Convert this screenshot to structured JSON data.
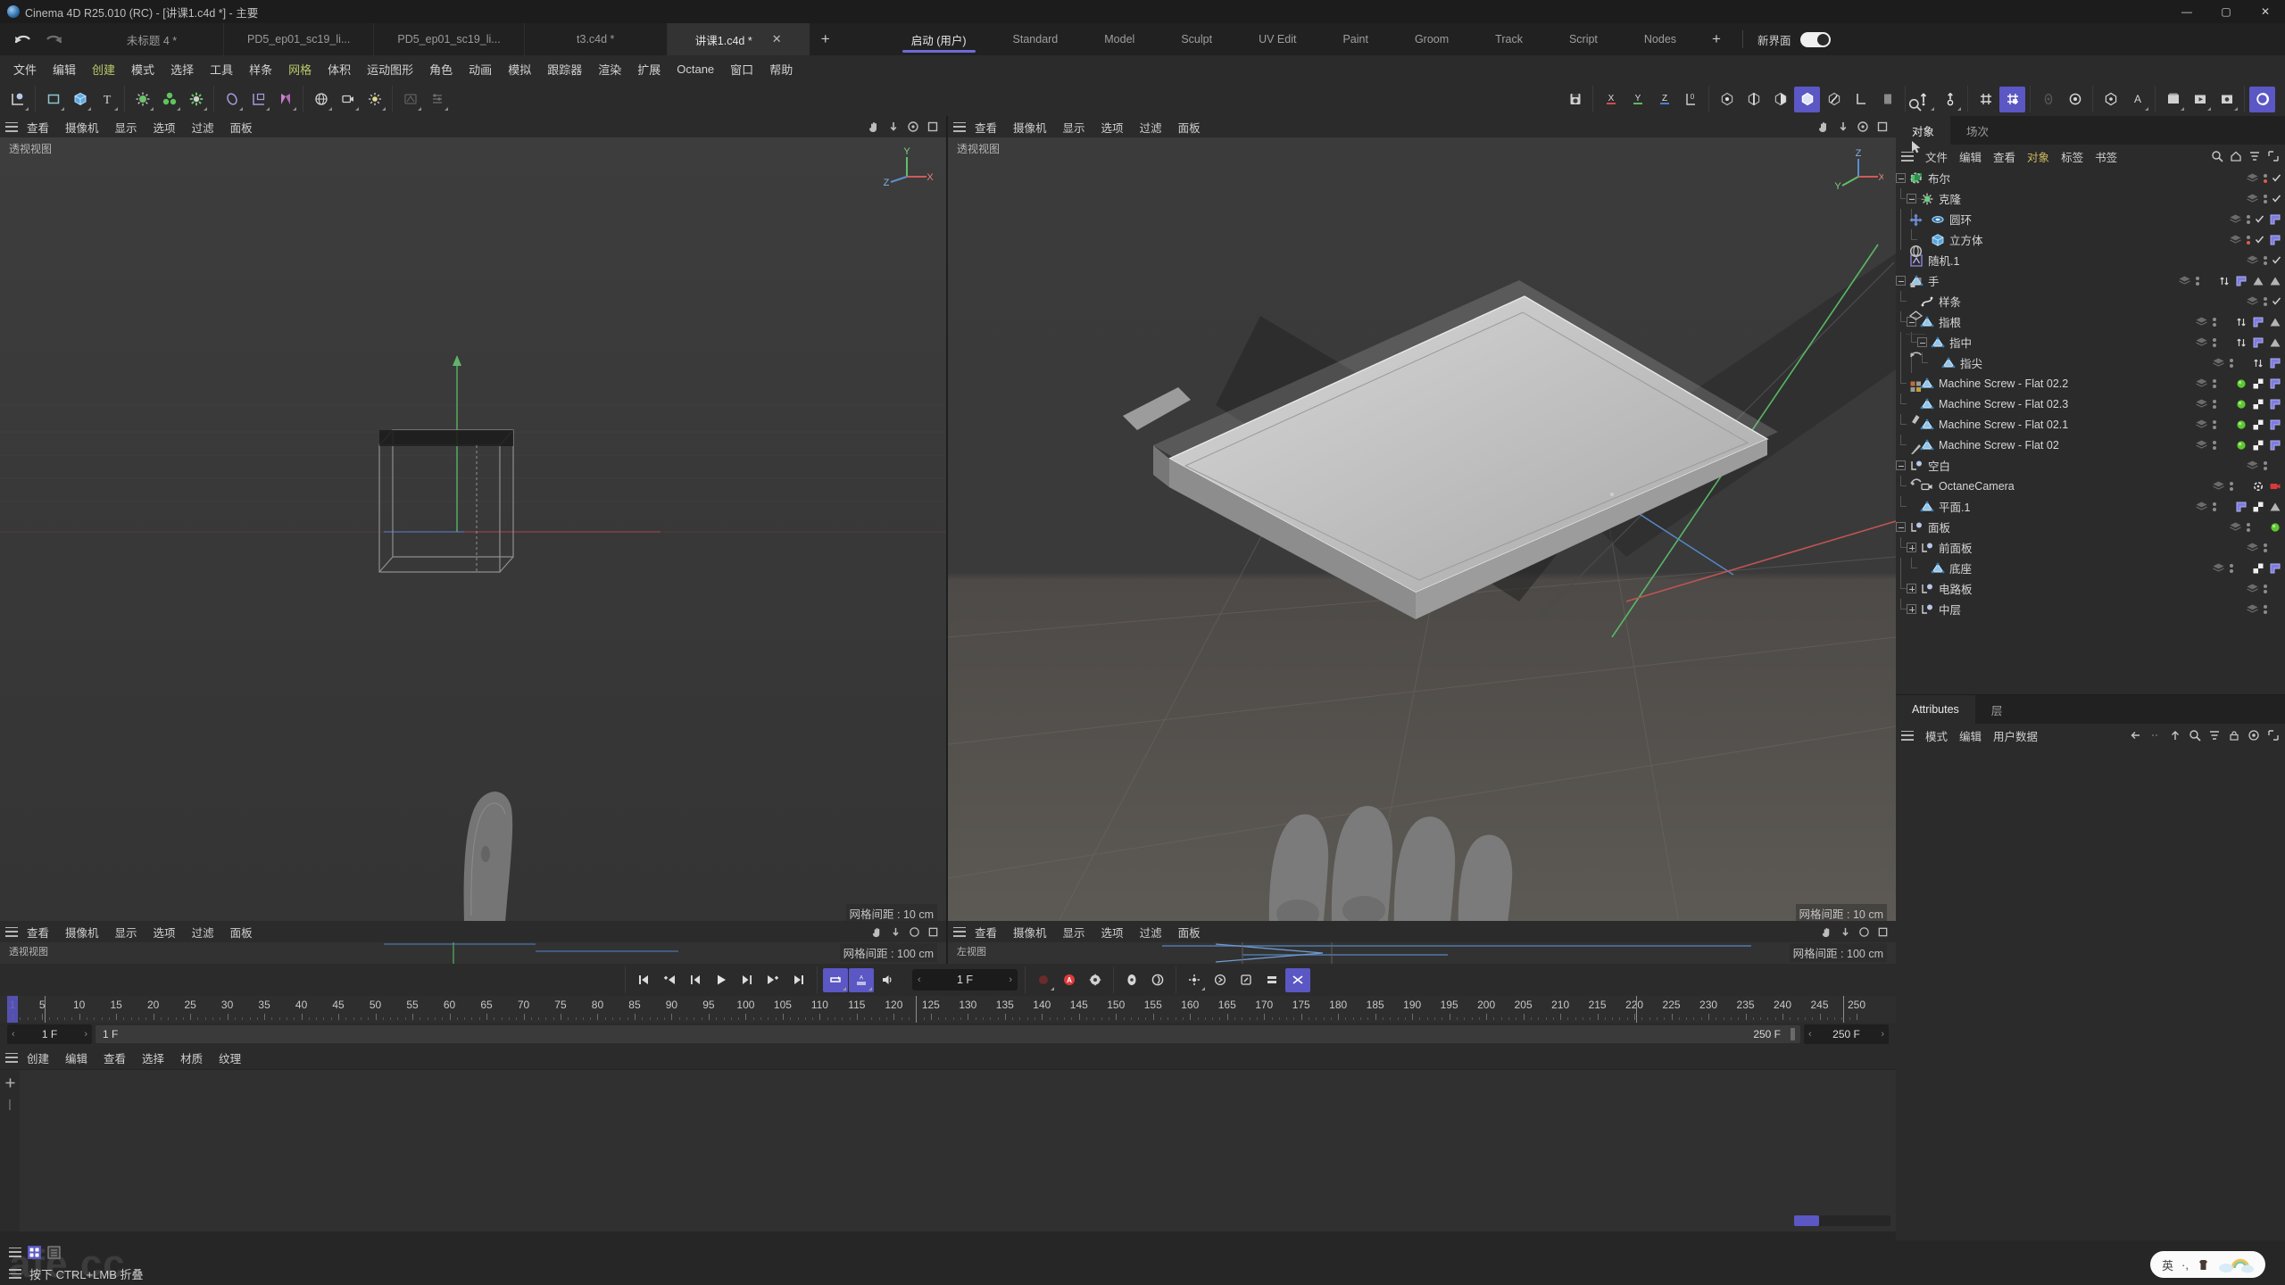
{
  "window": {
    "title": "Cinema 4D R25.010 (RC) - [讲课1.c4d *] - 主要",
    "minimize": "—",
    "maximize": "▢",
    "close": "✕"
  },
  "doc_tabs": [
    {
      "label": "未标题 4 *",
      "active": false,
      "closable": false
    },
    {
      "label": "PD5_ep01_sc19_li...",
      "active": false,
      "closable": false
    },
    {
      "label": "PD5_ep01_sc19_li...",
      "active": false,
      "closable": false
    },
    {
      "label": "t3.c4d *",
      "active": false,
      "closable": false
    },
    {
      "label": "讲课1.c4d *",
      "active": true,
      "closable": true
    }
  ],
  "doc_tab_add": "+",
  "layout_tabs": [
    {
      "label": "启动 (用户)",
      "active": true
    },
    {
      "label": "Standard",
      "active": false
    },
    {
      "label": "Model",
      "active": false
    },
    {
      "label": "Sculpt",
      "active": false
    },
    {
      "label": "UV Edit",
      "active": false
    },
    {
      "label": "Paint",
      "active": false
    },
    {
      "label": "Groom",
      "active": false
    },
    {
      "label": "Track",
      "active": false
    },
    {
      "label": "Script",
      "active": false
    },
    {
      "label": "Nodes",
      "active": false
    }
  ],
  "layout_add": "+",
  "new_ui": {
    "label": "新界面",
    "enabled": true
  },
  "menubar": [
    {
      "label": "文件",
      "hl": false
    },
    {
      "label": "编辑",
      "hl": false
    },
    {
      "label": "创建",
      "hl": true
    },
    {
      "label": "模式",
      "hl": false
    },
    {
      "label": "选择",
      "hl": false
    },
    {
      "label": "工具",
      "hl": false
    },
    {
      "label": "样条",
      "hl": false
    },
    {
      "label": "网格",
      "hl": true
    },
    {
      "label": "体积",
      "hl": false
    },
    {
      "label": "运动图形",
      "hl": false
    },
    {
      "label": "角色",
      "hl": false
    },
    {
      "label": "动画",
      "hl": false
    },
    {
      "label": "模拟",
      "hl": false
    },
    {
      "label": "跟踪器",
      "hl": false
    },
    {
      "label": "渲染",
      "hl": false
    },
    {
      "label": "扩展",
      "hl": false
    },
    {
      "label": "Octane",
      "hl": false
    },
    {
      "label": "窗口",
      "hl": false
    },
    {
      "label": "帮助",
      "hl": false
    }
  ],
  "viewports": {
    "menu": [
      "查看",
      "摄像机",
      "显示",
      "选项",
      "过滤",
      "面板"
    ],
    "left": {
      "label": "透视视图",
      "grid": "网格间距 : 10 cm"
    },
    "right": {
      "label": "透视视图",
      "grid": "网格间距 : 10 cm"
    },
    "left_bottom": {
      "label": "透视视图",
      "grid": "网格间距 : 100 cm"
    },
    "right_bottom": {
      "label": "左视图",
      "grid": "网格间距 : 100 cm"
    },
    "axis_labels": {
      "x": "X",
      "y": "Y",
      "z": "Z"
    }
  },
  "transport": {
    "current_frame": "1 F",
    "buttons": [
      "go-to-start",
      "previous-key",
      "previous-frame",
      "play",
      "next-frame",
      "next-key",
      "go-to-end"
    ],
    "loop": "loop",
    "sound": "sound"
  },
  "timeline": {
    "start": "1 F",
    "end": "250 F",
    "preview_min": "1 F",
    "preview_max": "250 F",
    "playhead": 1,
    "range_start": 1,
    "range_end": 250,
    "tick_step": 5,
    "ticks": [
      1,
      5,
      10,
      15,
      20,
      25,
      30,
      35,
      40,
      45,
      50,
      55,
      60,
      65,
      70,
      75,
      80,
      85,
      90,
      95,
      100,
      105,
      110,
      115,
      120,
      125,
      130,
      135,
      140,
      145,
      150,
      155,
      160,
      165,
      170,
      175,
      180,
      185,
      190,
      195,
      200,
      205,
      210,
      215,
      220,
      225,
      230,
      235,
      240,
      245,
      250
    ]
  },
  "material_manager": {
    "menu": [
      "创建",
      "编辑",
      "查看",
      "选择",
      "材质",
      "纹理"
    ]
  },
  "object_manager": {
    "tabs": [
      {
        "label": "对象",
        "active": true
      },
      {
        "label": "场次",
        "active": false
      }
    ],
    "menu": [
      {
        "label": "文件",
        "hl": false
      },
      {
        "label": "编辑",
        "hl": false
      },
      {
        "label": "查看",
        "hl": false
      },
      {
        "label": "对象",
        "hl": true
      },
      {
        "label": "标签",
        "hl": false
      },
      {
        "label": "书签",
        "hl": false
      }
    ],
    "items": [
      {
        "name": "布尔",
        "depth": 0,
        "expander": "open",
        "icon": "boole-icon",
        "dot": "red",
        "check": true,
        "tags": []
      },
      {
        "name": "克隆",
        "depth": 1,
        "expander": "open",
        "icon": "cloner-icon",
        "dot": "none",
        "check": true,
        "tags": []
      },
      {
        "name": "圆环",
        "depth": 2,
        "expander": "none",
        "icon": "circle-icon",
        "dot": "none",
        "check": true,
        "tags": [
          "flag"
        ]
      },
      {
        "name": "立方体",
        "depth": 2,
        "expander": "none",
        "icon": "cube-icon",
        "dot": "red",
        "check": true,
        "tags": [
          "flag"
        ]
      },
      {
        "name": "随机.1",
        "depth": 0,
        "expander": "none",
        "icon": "random-icon",
        "dot": "none",
        "check": true,
        "tags": []
      },
      {
        "name": "手",
        "depth": 0,
        "expander": "open",
        "icon": "poly-icon",
        "dot": "none",
        "check": false,
        "tags": [
          "updown",
          "flag",
          "tri",
          "tri"
        ]
      },
      {
        "name": "样条",
        "depth": 1,
        "expander": "none",
        "icon": "spline-icon",
        "dot": "none",
        "check": true,
        "tags": []
      },
      {
        "name": "指根",
        "depth": 1,
        "expander": "open",
        "icon": "poly-icon",
        "dot": "none",
        "check": false,
        "tags": [
          "updown",
          "flag",
          "tri"
        ]
      },
      {
        "name": "指中",
        "depth": 2,
        "expander": "open",
        "icon": "poly-icon",
        "dot": "none",
        "check": false,
        "tags": [
          "updown",
          "flag",
          "tri"
        ]
      },
      {
        "name": "指尖",
        "depth": 3,
        "expander": "none",
        "icon": "poly-icon",
        "dot": "none",
        "check": false,
        "tags": [
          "updown",
          "flag"
        ]
      },
      {
        "name": "Machine Screw - Flat 02.2",
        "depth": 1,
        "expander": "none",
        "icon": "poly-icon",
        "dot": "none",
        "check": false,
        "tags": [
          "green",
          "checker",
          "flag"
        ]
      },
      {
        "name": "Machine Screw - Flat 02.3",
        "depth": 1,
        "expander": "none",
        "icon": "poly-icon",
        "dot": "none",
        "check": false,
        "tags": [
          "green",
          "checker",
          "flag"
        ]
      },
      {
        "name": "Machine Screw - Flat 02.1",
        "depth": 1,
        "expander": "none",
        "icon": "poly-icon",
        "dot": "none",
        "check": false,
        "tags": [
          "green",
          "checker",
          "flag"
        ]
      },
      {
        "name": "Machine Screw - Flat 02",
        "depth": 1,
        "expander": "none",
        "icon": "poly-icon",
        "dot": "none",
        "check": false,
        "tags": [
          "green",
          "checker",
          "flag"
        ]
      },
      {
        "name": "空白",
        "depth": 0,
        "expander": "open",
        "icon": "null-icon",
        "dot": "none",
        "check": false,
        "tags": []
      },
      {
        "name": "OctaneCamera",
        "depth": 1,
        "expander": "none",
        "icon": "camera-icon",
        "dot": "none",
        "check": false,
        "tags": [
          "target",
          "redcam"
        ]
      },
      {
        "name": "平面.1",
        "depth": 1,
        "expander": "none",
        "icon": "poly-icon",
        "dot": "none",
        "check": false,
        "tags": [
          "flag",
          "checker",
          "tri"
        ]
      },
      {
        "name": "面板",
        "depth": 0,
        "expander": "open",
        "icon": "null-icon",
        "dot": "none",
        "check": false,
        "tags": [
          "green"
        ]
      },
      {
        "name": "前面板",
        "depth": 1,
        "expander": "closed",
        "icon": "null-icon",
        "dot": "none",
        "check": false,
        "tags": []
      },
      {
        "name": "底座",
        "depth": 2,
        "expander": "none",
        "icon": "poly-icon",
        "dot": "none",
        "check": false,
        "tags": [
          "checker",
          "flag"
        ]
      },
      {
        "name": "电路板",
        "depth": 1,
        "expander": "closed",
        "icon": "null-icon",
        "dot": "none",
        "check": false,
        "tags": []
      },
      {
        "name": "中层",
        "depth": 1,
        "expander": "closed",
        "icon": "null-icon",
        "dot": "none",
        "check": false,
        "tags": []
      }
    ]
  },
  "attributes": {
    "tabs": [
      {
        "label": "Attributes",
        "active": true
      },
      {
        "label": "层",
        "active": false
      }
    ],
    "menu": [
      "模式",
      "编辑",
      "用户数据"
    ]
  },
  "statusbar": {
    "message": "按下 CTRL+LMB 折叠",
    "watermark": "afe.cc"
  },
  "ime": {
    "lang": "英",
    "glyphs": [
      "·,",
      "♣",
      "☁",
      "☁"
    ]
  },
  "colors": {
    "accent": "#5b57c4",
    "menu_highlight": "#b9c96a",
    "om_highlight": "#ccb65e",
    "green_tag": "#5ec832",
    "red_dot": "#e05a4a",
    "panel_bg": "#2b2b2b",
    "viewport_bg": "#393939"
  }
}
